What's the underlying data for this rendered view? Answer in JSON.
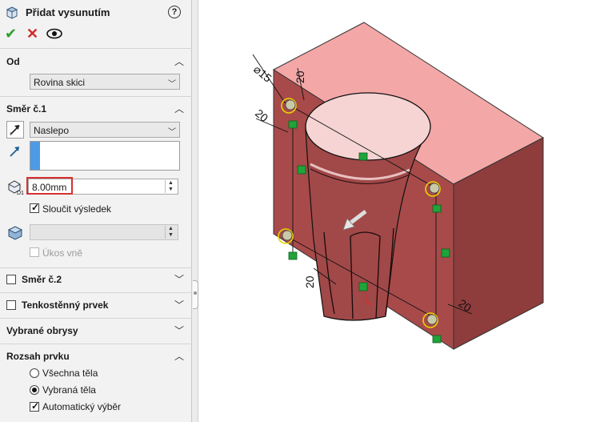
{
  "title": "Přidat vysunutím",
  "help_glyph": "?",
  "actions": {
    "ok": "✔",
    "cancel": "✕",
    "preview": "👁"
  },
  "sections": {
    "from": {
      "label": "Od",
      "value": "Rovina skici"
    },
    "direction1": {
      "label": "Směr č.1",
      "end_condition": "Naslepo",
      "depth": "8.00mm",
      "merge_label": "Sloučit výsledek",
      "merge_checked": true,
      "draft_outward_label": "Úkos vně",
      "draft_outward_checked": false
    },
    "direction2": {
      "label": "Směr č.2",
      "checked": false
    },
    "thin_feature": {
      "label": "Tenkostěnný prvek",
      "checked": false
    },
    "selected_contours": {
      "label": "Vybrané obrysy"
    },
    "feature_scope": {
      "label": "Rozsah prvku",
      "all_bodies": "Všechna těla",
      "selected_bodies": "Vybraná těla",
      "auto_select": "Automatický výběr",
      "selected_option": "selected_bodies",
      "auto_select_checked": true
    }
  },
  "model": {
    "dimensions": {
      "diameter": "⌀15",
      "top_dim": "20",
      "left_dim": "20",
      "bottom_dim": "20",
      "right_dim": "20"
    },
    "colors": {
      "block_top": "#f4a7a7",
      "block_front": "#a84a4a",
      "block_side": "#8e3c3c",
      "boss": "#a14848",
      "boss_top": "#f6d4d4",
      "accent": "#d8302f"
    }
  }
}
